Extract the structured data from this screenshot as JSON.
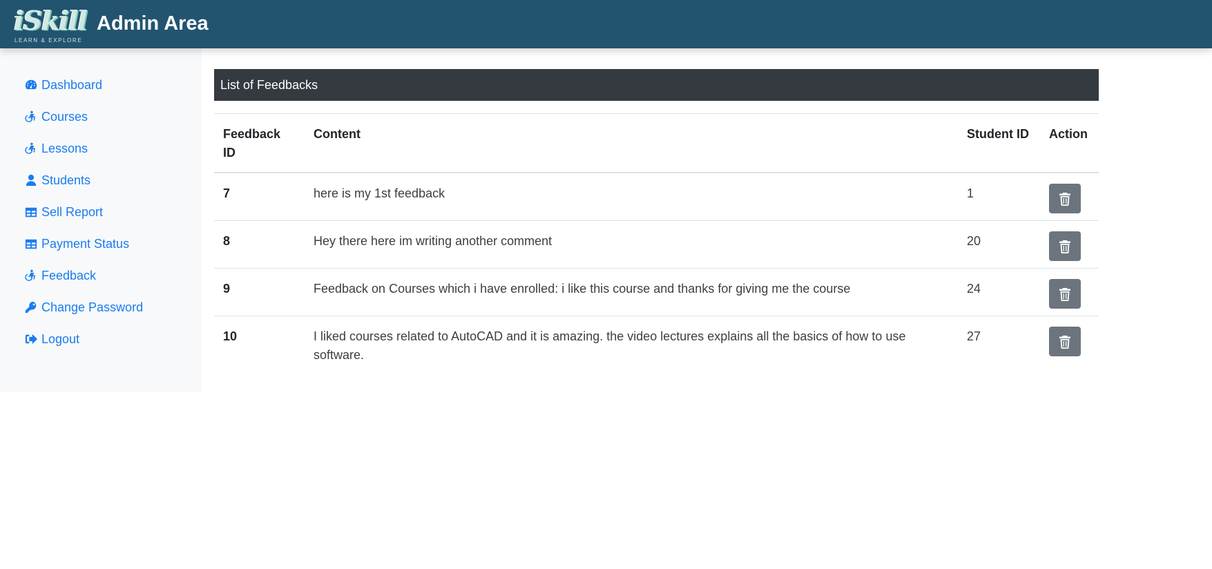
{
  "header": {
    "logo_text": "iSkill",
    "logo_tagline": "LEARN & EXPLORE",
    "title": "Admin Area"
  },
  "sidebar": {
    "items": [
      {
        "label": "Dashboard",
        "icon": "tachometer-icon"
      },
      {
        "label": "Courses",
        "icon": "accessible-icon"
      },
      {
        "label": "Lessons",
        "icon": "accessible-icon"
      },
      {
        "label": "Students",
        "icon": "user-icon"
      },
      {
        "label": "Sell Report",
        "icon": "table-icon"
      },
      {
        "label": "Payment Status",
        "icon": "table-icon"
      },
      {
        "label": "Feedback",
        "icon": "accessible-icon"
      },
      {
        "label": "Change Password",
        "icon": "key-icon"
      },
      {
        "label": "Logout",
        "icon": "sign-out-icon"
      }
    ]
  },
  "main": {
    "card_title": "List of Feedbacks",
    "table": {
      "headers": [
        "Feedback ID",
        "Content",
        "Student ID",
        "Action"
      ],
      "rows": [
        {
          "feedback_id": "7",
          "content": "here is my 1st feedback",
          "student_id": "1"
        },
        {
          "feedback_id": "8",
          "content": "Hey there here im writing another comment",
          "student_id": "20"
        },
        {
          "feedback_id": "9",
          "content": "Feedback on Courses which i have enrolled: i like this course and thanks for giving me the course",
          "student_id": "24"
        },
        {
          "feedback_id": "10",
          "content": "I liked courses related to AutoCAD and it is amazing. the video lectures explains all the basics of how to use software.",
          "student_id": "27"
        }
      ]
    }
  },
  "colors": {
    "topbar": "#225470",
    "sidebar_bg": "#f8f9fa",
    "link": "#1a7cf0",
    "card_header": "#343a40",
    "delete_button": "#6c757d"
  }
}
